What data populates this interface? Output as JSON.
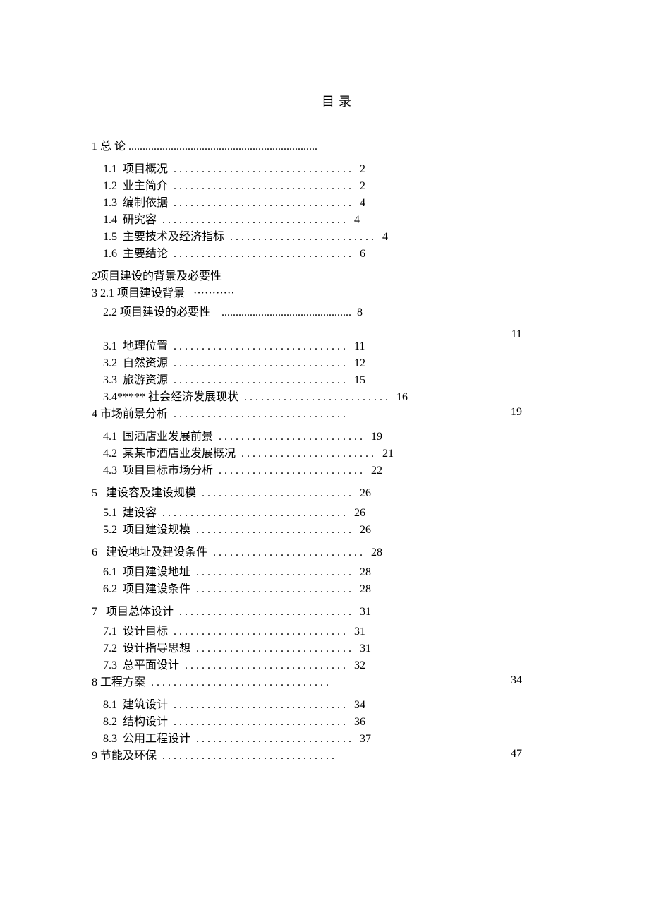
{
  "title": "目录",
  "lines": {
    "l1": "1 总 论 ...................................................................",
    "l2": "    1.1  项目概况  . . . . . . . . . . . . . . . . . . . . . . . . . . . . . . . .   2",
    "l3": "    1.2  业主简介  . . . . . . . . . . . . . . . . . . . . . . . . . . . . . . . .   2",
    "l4": "    1.3  编制依据  . . . . . . . . . . . . . . . . . . . . . . . . . . . . . . . .   4",
    "l5": "    1.4  研究容  . . . . . . . . . . . . . . . . . . . . . . . . . . . . . . . . .   4",
    "l6": "    1.5  主要技术及经济指标  . . . . . . . . . . . . . . . . . . . . . . . . . .   4",
    "l7": "    1.6  主要结论  . . . . . . . . . . . . . . . . . . . . . . . . . . . . . . . .   6",
    "l8": "2项目建设的背景及必要性",
    "l9a": "3",
    "l9b": " 2.1 项目建设背景   ···········",
    "l10": "    2.2 项目建设的必要性    ..............................................  8",
    "side1": "11",
    "l11": "    3.1  地理位置  . . . . . . . . . . . . . . . . . . . . . . . . . . . . . . .   11",
    "l12": "    3.2  自然资源  . . . . . . . . . . . . . . . . . . . . . . . . . . . . . . .   12",
    "l13": "    3.3  旅游资源  . . . . . . . . . . . . . . . . . . . . . . . . . . . . . . .   15",
    "l14": "    3.4***** 社会经济发展现状  . . . . . . . . . . . . . . . . . . . . . . . . . .   16",
    "l15": "4 市场前景分析  . . . . . . . . . . . . . . . . . . . . . . . . . . . . . . .",
    "side2": "19",
    "l16": "    4.1  国酒店业发展前景  . . . . . . . . . . . . . . . . . . . . . . . . . .   19",
    "l17": "    4.2  某某市酒店业发展概况  . . . . . . . . . . . . . . . . . . . . . . . .   21",
    "l18": "    4.3  项目目标市场分析  . . . . . . . . . . . . . . . . . . . . . . . . . .   22",
    "l19": "5   建设容及建设规模  . . . . . . . . . . . . . . . . . . . . . . . . . . .   26",
    "l20": "    5.1  建设容  . . . . . . . . . . . . . . . . . . . . . . . . . . . . . . . . .   26",
    "l21": "    5.2  项目建设规模  . . . . . . . . . . . . . . . . . . . . . . . . . . . .   26",
    "l22": "6   建设地址及建设条件  . . . . . . . . . . . . . . . . . . . . . . . . . . .   28",
    "l23": "    6.1  项目建设地址  . . . . . . . . . . . . . . . . . . . . . . . . . . . .   28",
    "l24": "    6.2  项目建设条件  . . . . . . . . . . . . . . . . . . . . . . . . . . . .   28",
    "l25": "7   项目总体设计  . . . . . . . . . . . . . . . . . . . . . . . . . . . . . . .   31",
    "l26": "    7.1  设计目标  . . . . . . . . . . . . . . . . . . . . . . . . . . . . . . .   31",
    "l27": "    7.2  设计指导思想  . . . . . . . . . . . . . . . . . . . . . . . . . . . .   31",
    "l28": "    7.3  总平面设计  . . . . . . . . . . . . . . . . . . . . . . . . . . . . .   32",
    "l29": "8 工程方案  . . . . . . . . . . . . . . . . . . . . . . . . . . . . . . . .",
    "side3": "34",
    "l30": "    8.1  建筑设计  . . . . . . . . . . . . . . . . . . . . . . . . . . . . . . .   34",
    "l31": "    8.2  结构设计  . . . . . . . . . . . . . . . . . . . . . . . . . . . . . . .   36",
    "l32": "    8.3  公用工程设计  . . . . . . . . . . . . . . . . . . . . . . . . . . . .   37",
    "l33": "9 节能及环保  . . . . . . . . . . . . . . . . . . . . . . . . . . . . . . .",
    "side4": "47"
  }
}
